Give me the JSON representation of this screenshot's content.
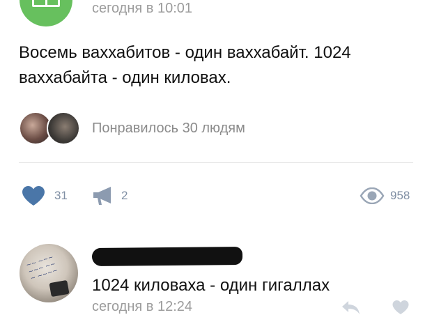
{
  "post": {
    "time": "сегодня в 10:01",
    "text": "Восемь ваххабитов - один ваххабайт. 1024 ваххабайта - один киловах.",
    "liked_by_text": "Понравилось 30 людям",
    "likes_count": "31",
    "reposts_count": "2",
    "views_count": "958"
  },
  "comment": {
    "text": "1024 киловаха - один гигаллах",
    "time": "сегодня в 12:24"
  },
  "icons": {
    "like": "heart-icon",
    "repost": "megaphone-icon",
    "views": "eye-icon",
    "reply": "reply-arrow-icon",
    "comment_like": "heart-outline-icon"
  },
  "colors": {
    "accent": "#4a76a8",
    "group_avatar": "#67c05e",
    "muted_text": "#9c9c9c"
  }
}
